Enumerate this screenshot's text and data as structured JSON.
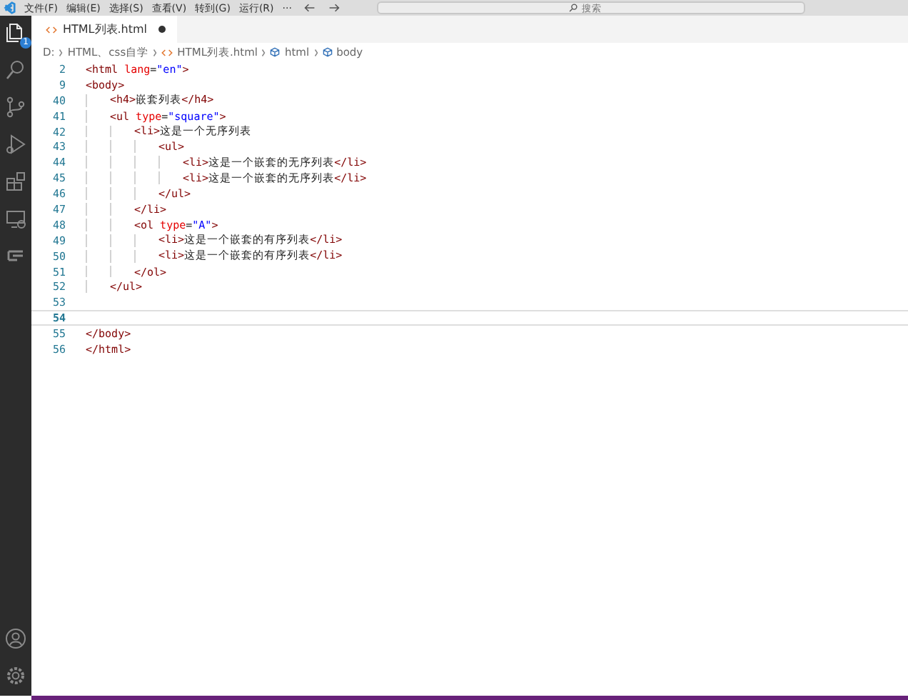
{
  "menu": [
    "文件(F)",
    "编辑(E)",
    "选择(S)",
    "查看(V)",
    "转到(G)",
    "运行(R)",
    "···"
  ],
  "search": {
    "placeholder": "搜索"
  },
  "activity": [
    {
      "selected": true,
      "badge": "1"
    },
    {
      "selected": false
    },
    {
      "selected": false
    },
    {
      "selected": false
    },
    {
      "selected": false
    },
    {
      "selected": false
    },
    {
      "selected": false
    }
  ],
  "tabs": [
    {
      "label": "HTML列表.html",
      "selected": true,
      "modified": true
    }
  ],
  "breadcrumb": [
    {
      "kind": "folder",
      "text": "D:"
    },
    {
      "kind": "folder",
      "text": "HTML、css自学"
    },
    {
      "kind": "file",
      "text": "HTML列表.html"
    },
    {
      "kind": "element",
      "text": "html"
    },
    {
      "kind": "element",
      "text": "body"
    }
  ],
  "lines": [
    {
      "number": "2",
      "current": false,
      "segments": [
        {
          "kind": "tag",
          "text": "<html"
        },
        {
          "kind": "attr",
          "text": " lang"
        },
        {
          "kind": "text",
          "text": "="
        },
        {
          "kind": "string",
          "text": "\"en\""
        },
        {
          "kind": "tag",
          "text": ">"
        }
      ]
    },
    {
      "number": "9",
      "current": false,
      "segments": [
        {
          "kind": "tag",
          "text": "<body>"
        }
      ],
      "children": [
        {
          "number": "40",
          "current": false,
          "segments": [
            {
              "kind": "tag",
              "text": "<h4>"
            },
            {
              "kind": "text",
              "text": "嵌套列表"
            },
            {
              "kind": "tag",
              "text": "</h4>"
            }
          ]
        },
        {
          "number": "41",
          "current": false,
          "segments": [
            {
              "kind": "tag",
              "text": "<ul"
            },
            {
              "kind": "attr",
              "text": " type"
            },
            {
              "kind": "text",
              "text": "="
            },
            {
              "kind": "string",
              "text": "\"square\""
            },
            {
              "kind": "tag",
              "text": ">"
            }
          ],
          "children": [
            {
              "number": "42",
              "current": false,
              "segments": [
                {
                  "kind": "tag",
                  "text": "<li>"
                },
                {
                  "kind": "text",
                  "text": "这是一个无序列表"
                }
              ],
              "children": [
                {
                  "number": "43",
                  "current": false,
                  "segments": [
                    {
                      "kind": "tag",
                      "text": "<ul>"
                    }
                  ],
                  "children": [
                    {
                      "number": "44",
                      "current": false,
                      "segments": [
                        {
                          "kind": "tag",
                          "text": "<li>"
                        },
                        {
                          "kind": "text",
                          "text": "这是一个嵌套的无序列表"
                        },
                        {
                          "kind": "tag",
                          "text": "</li>"
                        }
                      ]
                    },
                    {
                      "number": "45",
                      "current": false,
                      "segments": [
                        {
                          "kind": "tag",
                          "text": "<li>"
                        },
                        {
                          "kind": "text",
                          "text": "这是一个嵌套的无序列表"
                        },
                        {
                          "kind": "tag",
                          "text": "</li>"
                        }
                      ]
                    }
                  ]
                },
                {
                  "number": "46",
                  "current": false,
                  "segments": [
                    {
                      "kind": "tag",
                      "text": "</ul>"
                    }
                  ]
                }
              ]
            },
            {
              "number": "47",
              "current": false,
              "segments": [
                {
                  "kind": "tag",
                  "text": "</li>"
                }
              ]
            },
            {
              "number": "48",
              "current": false,
              "segments": [
                {
                  "kind": "tag",
                  "text": "<ol"
                },
                {
                  "kind": "attr",
                  "text": " type"
                },
                {
                  "kind": "text",
                  "text": "="
                },
                {
                  "kind": "string",
                  "text": "\"A\""
                },
                {
                  "kind": "tag",
                  "text": ">"
                }
              ],
              "children": [
                {
                  "number": "49",
                  "current": false,
                  "segments": [
                    {
                      "kind": "tag",
                      "text": "<li>"
                    },
                    {
                      "kind": "text",
                      "text": "这是一个嵌套的有序列表"
                    },
                    {
                      "kind": "tag",
                      "text": "</li>"
                    }
                  ]
                },
                {
                  "number": "50",
                  "current": false,
                  "segments": [
                    {
                      "kind": "tag",
                      "text": "<li>"
                    },
                    {
                      "kind": "text",
                      "text": "这是一个嵌套的有序列表"
                    },
                    {
                      "kind": "tag",
                      "text": "</li>"
                    }
                  ]
                }
              ]
            },
            {
              "number": "51",
              "current": false,
              "segments": [
                {
                  "kind": "tag",
                  "text": "</ol>"
                }
              ]
            }
          ]
        },
        {
          "number": "52",
          "current": false,
          "segments": [
            {
              "kind": "tag",
              "text": "</ul>"
            }
          ]
        }
      ]
    },
    {
      "number": "53",
      "current": false
    },
    {
      "number": "54",
      "current": true
    },
    {
      "number": "55",
      "current": false,
      "segments": [
        {
          "kind": "tag",
          "text": "</body>"
        }
      ]
    },
    {
      "number": "56",
      "current": false,
      "segments": [
        {
          "kind": "tag",
          "text": "</html>"
        }
      ]
    }
  ]
}
